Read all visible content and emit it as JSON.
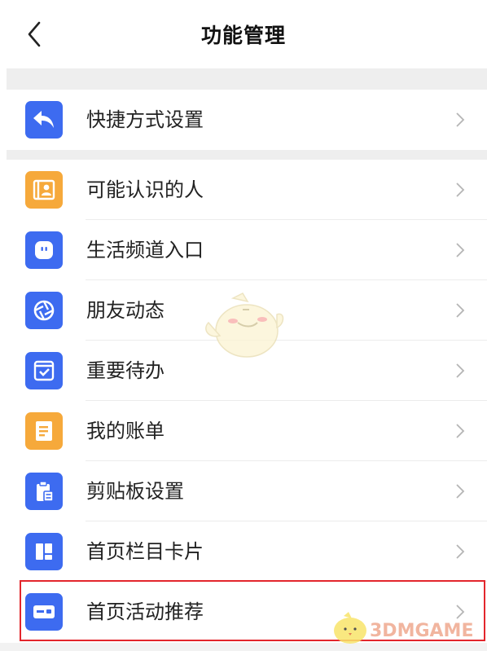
{
  "header": {
    "title": "功能管理"
  },
  "sections": [
    {
      "items": [
        {
          "label": "快捷方式设置",
          "icon": "reply-arrow-icon",
          "color": "#3d6bf0"
        }
      ]
    },
    {
      "items": [
        {
          "label": "可能认识的人",
          "icon": "contact-card-icon",
          "color": "#f6a93b"
        },
        {
          "label": "生活频道入口",
          "icon": "life-channel-icon",
          "color": "#3d6bf0"
        },
        {
          "label": "朋友动态",
          "icon": "aperture-icon",
          "color": "#3d6bf0"
        },
        {
          "label": "重要待办",
          "icon": "todo-check-icon",
          "color": "#3d6bf0"
        },
        {
          "label": "我的账单",
          "icon": "bill-icon",
          "color": "#f6a93b"
        },
        {
          "label": "剪贴板设置",
          "icon": "clipboard-icon",
          "color": "#3d6bf0"
        },
        {
          "label": "首页栏目卡片",
          "icon": "layout-card-icon",
          "color": "#3d6bf0"
        },
        {
          "label": "首页活动推荐",
          "icon": "activity-card-icon",
          "color": "#3d6bf0"
        }
      ]
    }
  ],
  "watermark": "3DMGAME"
}
